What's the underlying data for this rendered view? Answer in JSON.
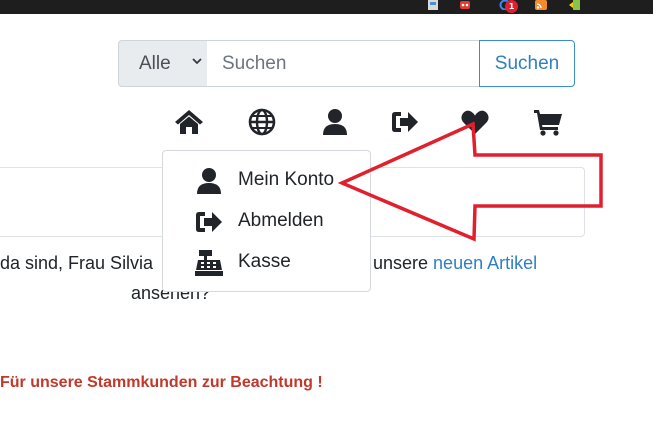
{
  "browser": {
    "extension_badge": "1",
    "extension_icons": [
      "document-icon",
      "robot-icon",
      "google-icon",
      "rss-icon",
      "exit-door-icon"
    ]
  },
  "search": {
    "category_selected": "Alle",
    "placeholder": "Suchen",
    "button_label": "Suchen"
  },
  "nav": {
    "icons": [
      "home-icon",
      "globe-icon",
      "user-icon",
      "sign-out-icon",
      "heart-icon",
      "cart-icon"
    ]
  },
  "dropdown": {
    "items": [
      {
        "label": "Mein Konto",
        "icon": "user-icon"
      },
      {
        "label": "Abmelden",
        "icon": "sign-out-icon"
      },
      {
        "label": "Kasse",
        "icon": "cash-register-icon"
      }
    ]
  },
  "content": {
    "welcome_left": "da sind, Frau Silvia",
    "welcome_right_prefix": "unsere ",
    "welcome_link": "neuen Artikel",
    "welcome_line2": "ansehen?",
    "notice": "Für unsere Stammkunden zur Beachtung !"
  },
  "colors": {
    "accent": "#2f7fc1",
    "notice": "#c0392b",
    "annotation_arrow": "#e0202e",
    "icon": "#212529"
  }
}
